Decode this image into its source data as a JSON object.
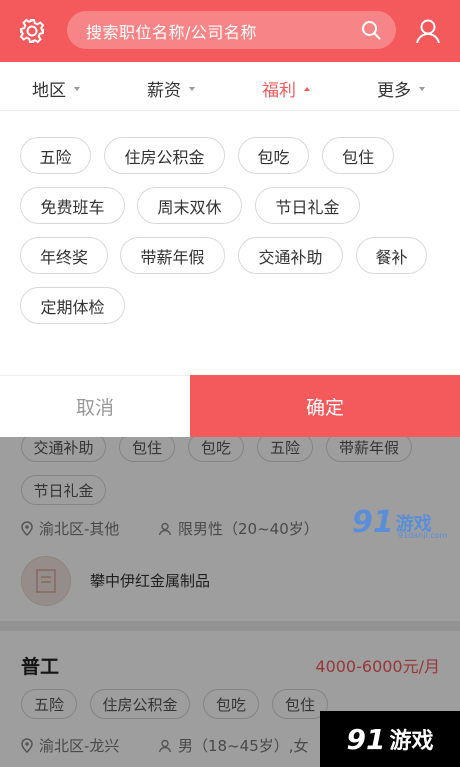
{
  "header": {
    "search_placeholder": "搜索职位名称/公司名称",
    "settings_icon": "gear-icon",
    "user_icon": "user-icon",
    "brand_color": "#f4595b"
  },
  "filters": [
    {
      "label": "地区",
      "active": false
    },
    {
      "label": "薪资",
      "active": false
    },
    {
      "label": "福利",
      "active": true
    },
    {
      "label": "更多",
      "active": false
    }
  ],
  "benefit_tags": [
    "五险",
    "住房公积金",
    "包吃",
    "包住",
    "免费班车",
    "周末双休",
    "节日礼金",
    "年终奖",
    "带薪年假",
    "交通补助",
    "餐补",
    "定期体检"
  ],
  "buttons": {
    "cancel": "取消",
    "confirm": "确定"
  },
  "job_list": [
    {
      "tags": [
        "交通补助",
        "包住",
        "包吃",
        "五险",
        "带薪年假",
        "节日礼金"
      ],
      "location": "渝北区-其他",
      "requirement": "限男性（20~40岁）",
      "company": "攀中伊红金属制品"
    },
    {
      "title": "普工",
      "salary": "4000-6000元/月",
      "tags": [
        "五险",
        "住房公积金",
        "包吃",
        "包住"
      ],
      "location": "渝北区-龙兴",
      "requirement": "男（18~45岁）,女"
    }
  ],
  "watermark": {
    "logo": "91",
    "name": "游戏",
    "url": "91danji.com"
  }
}
